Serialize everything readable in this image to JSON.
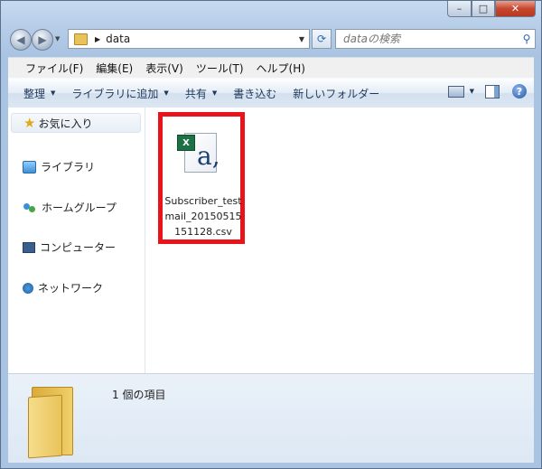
{
  "title_buttons": {
    "minimize": "–",
    "maximize": "□",
    "close": "✕"
  },
  "address_bar": {
    "path": "data",
    "search_placeholder": "dataの検索"
  },
  "menu": [
    "ファイル(F)",
    "編集(E)",
    "表示(V)",
    "ツール(T)",
    "ヘルプ(H)"
  ],
  "command_bar": {
    "organize": "整理",
    "add_to_library": "ライブラリに追加",
    "share": "共有",
    "burn": "書き込む",
    "new_folder": "新しいフォルダー"
  },
  "nav_pane": {
    "favorites": "お気に入り",
    "libraries": "ライブラリ",
    "homegroup": "ホームグループ",
    "computer": "コンピューター",
    "network": "ネットワーク"
  },
  "file": {
    "name": "Subscriber_testmail_20150515151128.csv",
    "highlight_color": "#e8141a"
  },
  "details": {
    "item_count": "1 個の項目"
  }
}
